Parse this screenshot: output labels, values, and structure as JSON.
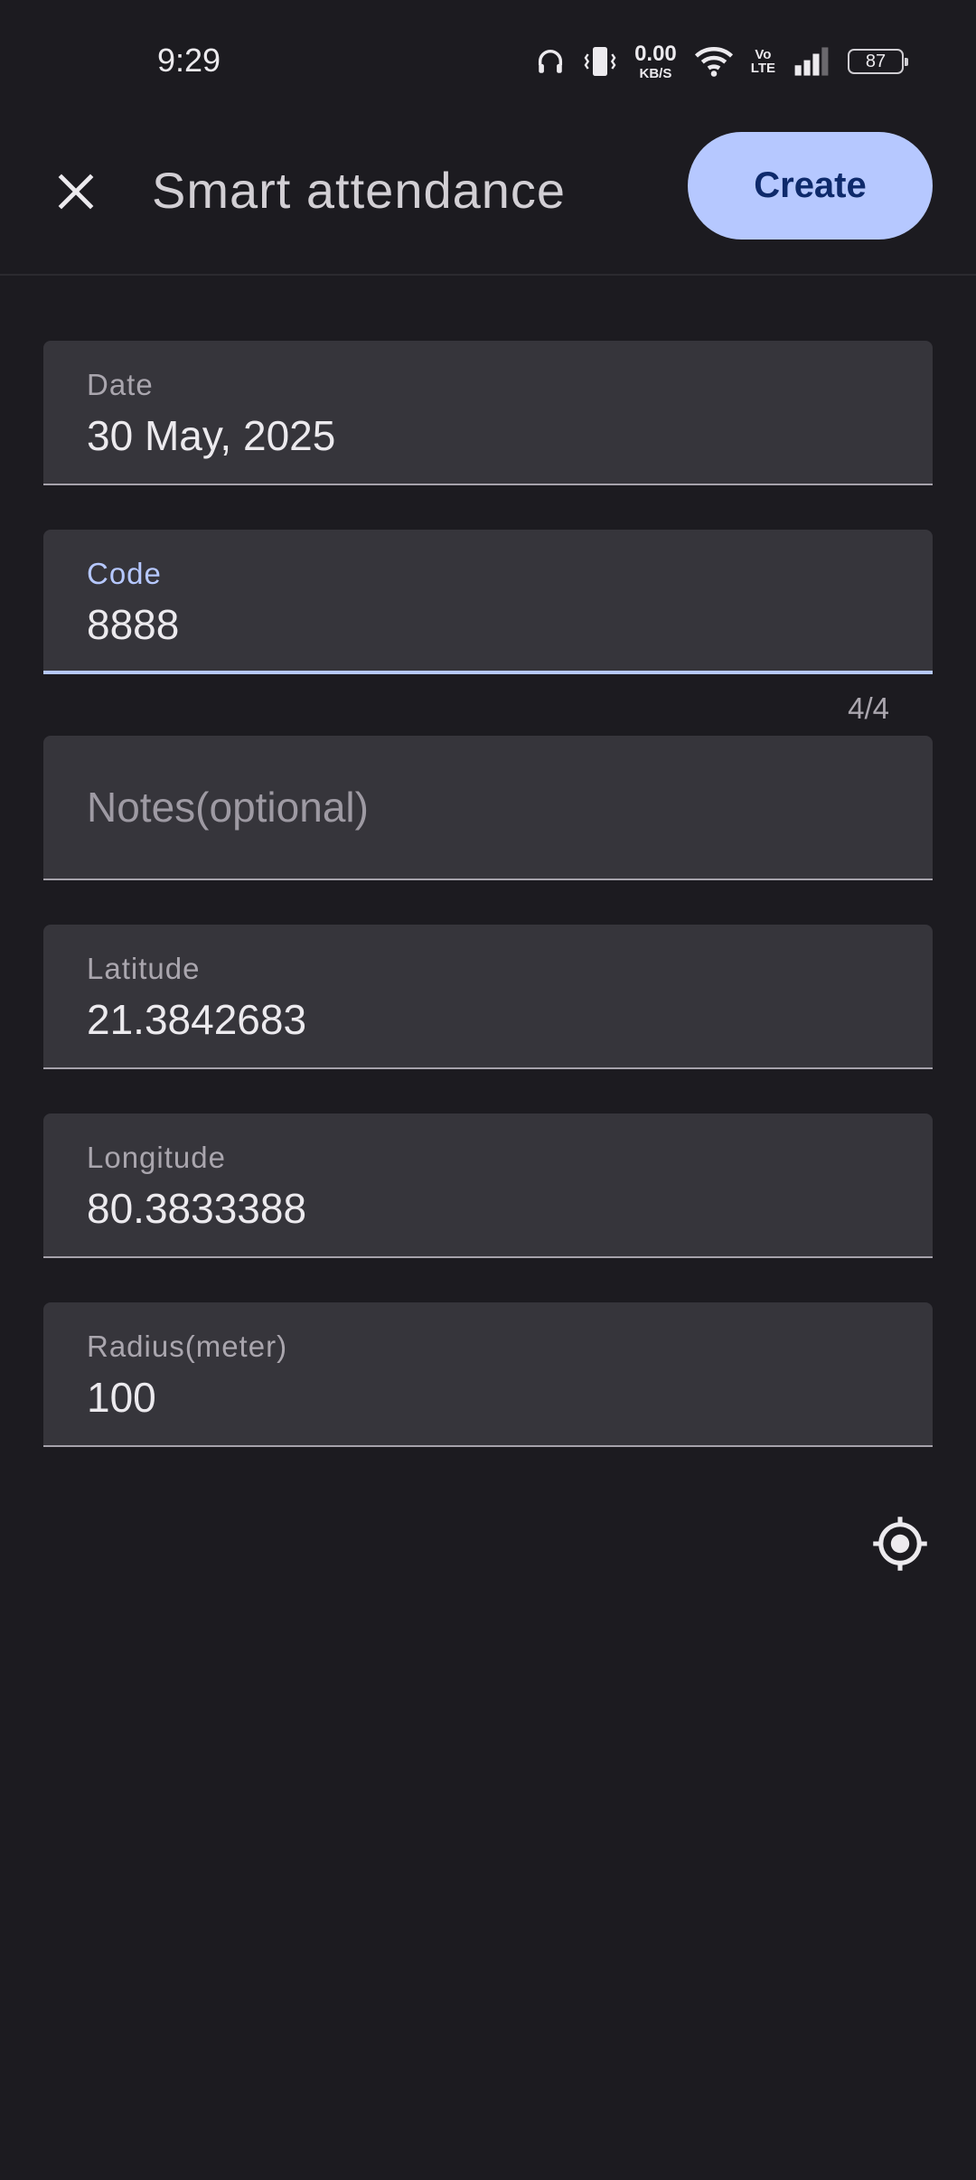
{
  "status_bar": {
    "time": "9:29",
    "net_speed_value": "0.00",
    "net_speed_unit": "KB/S",
    "volte_line1": "Vo",
    "volte_line2": "LTE",
    "battery_level": "87",
    "icons": [
      "headphones-icon",
      "vibrate-icon",
      "wifi-icon",
      "signal-icon",
      "battery-icon"
    ]
  },
  "app_bar": {
    "close_icon": "close-icon",
    "title": "Smart attendance",
    "create_label": "Create"
  },
  "form": {
    "date": {
      "label": "Date",
      "value": "30 May, 2025"
    },
    "code": {
      "label": "Code",
      "value": "8888",
      "counter": "4/4"
    },
    "notes": {
      "placeholder": "Notes(optional)",
      "value": ""
    },
    "latitude": {
      "label": "Latitude",
      "value": "21.3842683"
    },
    "longitude": {
      "label": "Longitude",
      "value": "80.3833388"
    },
    "radius": {
      "label": "Radius(meter)",
      "value": "100"
    }
  },
  "actions": {
    "locate_icon": "my-location-icon"
  },
  "colors": {
    "background": "#1c1b20",
    "field_background": "#36353b",
    "accent": "#b6c8ff",
    "accent_text": "#0e2a6b"
  }
}
